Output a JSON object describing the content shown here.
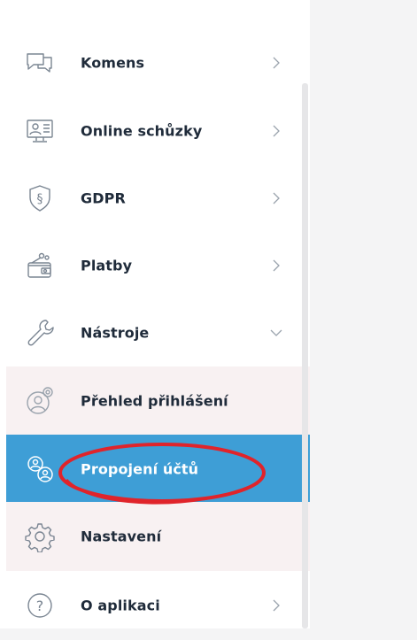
{
  "menu": {
    "items": [
      {
        "label": "Komens"
      },
      {
        "label": "Online schůzky"
      },
      {
        "label": "GDPR"
      },
      {
        "label": "Platby"
      },
      {
        "label": "Nástroje"
      },
      {
        "label": "Přehled přihlášení"
      },
      {
        "label": "Propojení účtů"
      },
      {
        "label": "Nastavení"
      },
      {
        "label": "O aplikaci"
      }
    ]
  },
  "colors": {
    "active_bg": "#3e9ed6",
    "submenu_bg": "#f8f1f2",
    "icon_stroke": "#7a8592",
    "annotation": "#e0242b"
  }
}
